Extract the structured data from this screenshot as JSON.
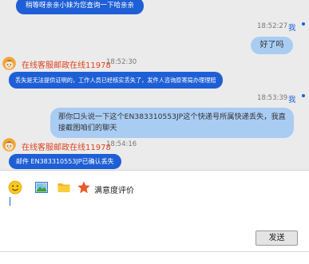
{
  "messages": {
    "m1_agent_text": "稍等呀亲亲小妹为您查询一下哈亲亲",
    "m2_time": "18:52:27",
    "m2_sender": "我",
    "m2_user_text": "好了吗",
    "m3_agent_name": "在线客服邮政在线11978",
    "m3_time": "18:52:30",
    "m3_agent_text": "丢失是无法提供证明的，工作人员已经核实丢失了，发件人咨询原寄局办理理赔",
    "m4_time": "18:53:39",
    "m4_sender": "我",
    "m4_user_text": "那你口头说一下这个EN383310553JP这个快递号所属快递丢失，我直接截图咱们的聊天",
    "m5_agent_name": "在线客服邮政在线11978",
    "m5_time": "18:54:16",
    "m5_agent_text": "邮件 EN383310553JP已确认丢失"
  },
  "toolbar": {
    "icons": [
      "emoji-icon",
      "image-icon",
      "folder-icon",
      "star-icon"
    ],
    "rating_label": "满意度评价"
  },
  "input": {
    "value": ""
  },
  "send_label": "发送",
  "colors": {
    "agent_bubble": "#1f5fd6",
    "user_bubble": "#a9ccf3",
    "agent_name": "#e0421c",
    "me_label": "#1f5fd6"
  }
}
